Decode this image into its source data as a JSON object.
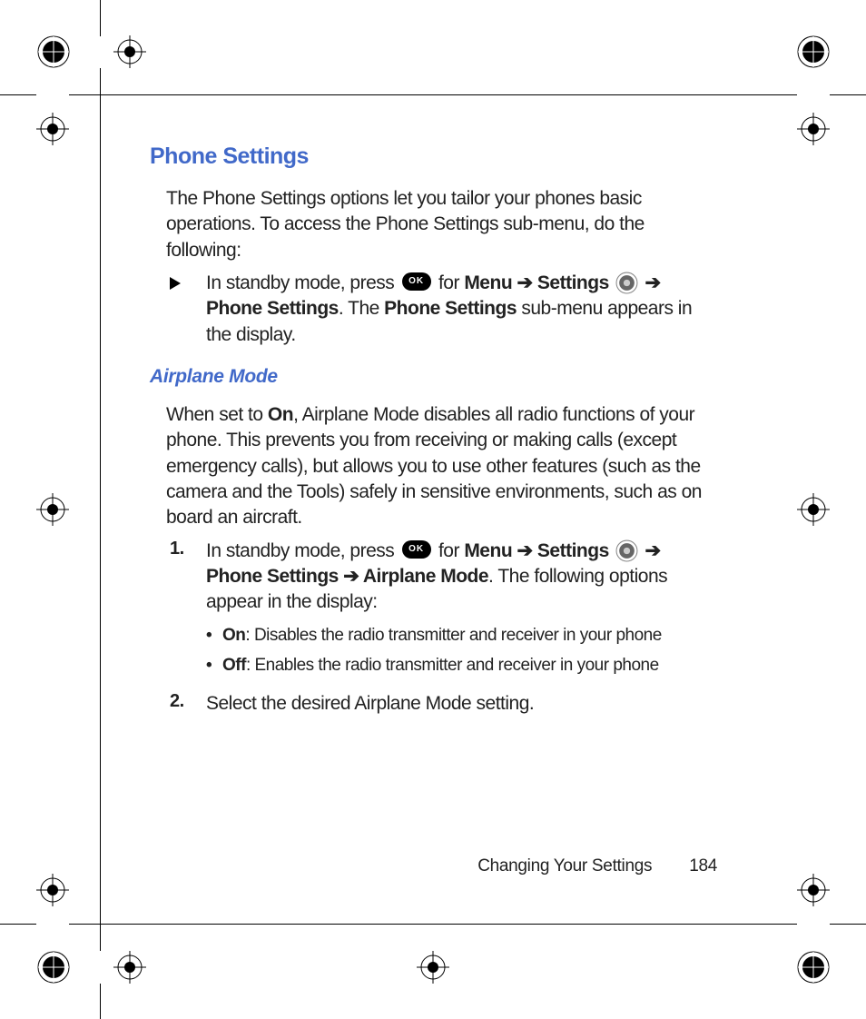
{
  "headings": {
    "main": "Phone Settings",
    "sub": "Airplane Mode"
  },
  "paras": {
    "intro": "The Phone Settings options let you tailor your phones basic operations. To access the Phone Settings sub-menu, do the following:",
    "airplane_intro_1": "When set to ",
    "airplane_intro_on": "On",
    "airplane_intro_2": ", Airplane Mode disables all radio functions of your phone. This prevents you from receiving or making calls (except emergency calls), but allows you to use other features (such as the camera and the Tools) safely in sensitive environments, such as on board an aircraft."
  },
  "icons": {
    "ok_label": "OK"
  },
  "step_tri": {
    "pre": "In standby mode, press ",
    "for": " for ",
    "menu": "Menu",
    "arrow": " ➔ ",
    "settings": "Settings",
    "phone_settings": "Phone Settings",
    "tail1": ". The ",
    "ps_bold": "Phone Settings",
    "tail2": " sub-menu appears in the display."
  },
  "step1": {
    "num": "1.",
    "pre": "In standby mode, press ",
    "for": " for ",
    "menu": "Menu",
    "arrow": " ➔ ",
    "settings": "Settings",
    "phone_settings": "Phone Settings",
    "airplane_mode": "Airplane Mode",
    "tail": ". The following options appear in the display:"
  },
  "bullets": {
    "on_b": "On",
    "on_t": ": Disables the radio transmitter and receiver in your phone",
    "off_b": "Off",
    "off_t": ": Enables the radio transmitter and receiver in your phone"
  },
  "step2": {
    "num": "2.",
    "text": "Select the desired Airplane Mode setting."
  },
  "footer": {
    "chapter": "Changing Your Settings",
    "page": "184"
  }
}
